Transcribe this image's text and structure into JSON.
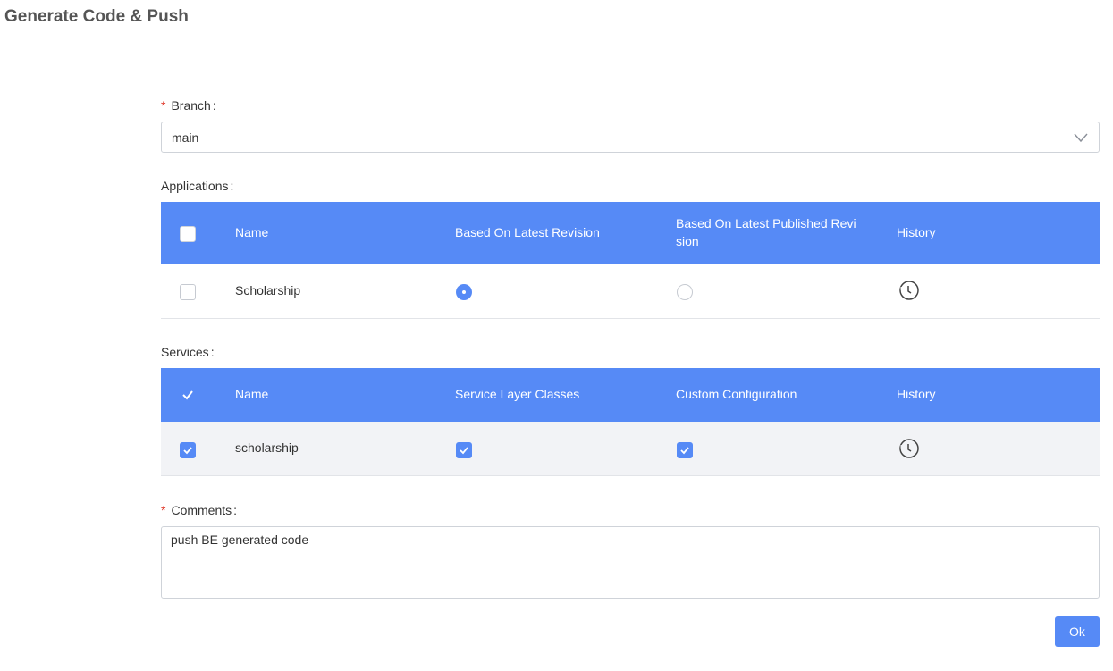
{
  "page": {
    "title": "Generate Code & Push"
  },
  "branch": {
    "label": "Branch",
    "colon": ":",
    "required_mark": "*",
    "value": "main"
  },
  "applications": {
    "label": "Applications",
    "colon": ":",
    "headers": [
      "Name",
      "Based On Latest Revision",
      "Based On Latest Published Revi",
      "sion",
      "History"
    ],
    "rows": [
      {
        "name": "Scholarship",
        "latest_revision": true,
        "latest_published": false,
        "checked": false
      }
    ]
  },
  "services": {
    "label": "Services",
    "colon": ":",
    "headers": [
      "Name",
      "Service Layer Classes",
      "Custom Configuration",
      "History"
    ],
    "rows": [
      {
        "name": "scholarship",
        "service_layer": true,
        "custom_config": true,
        "checked": true
      }
    ]
  },
  "comments": {
    "label": "Comments",
    "colon": ":",
    "required_mark": "*",
    "value": "push BE generated code"
  },
  "ok_button": {
    "label": "Ok"
  },
  "colors": {
    "accent": "#568af6",
    "required": "#e0392b",
    "row_selected": "#f2f3f6"
  }
}
